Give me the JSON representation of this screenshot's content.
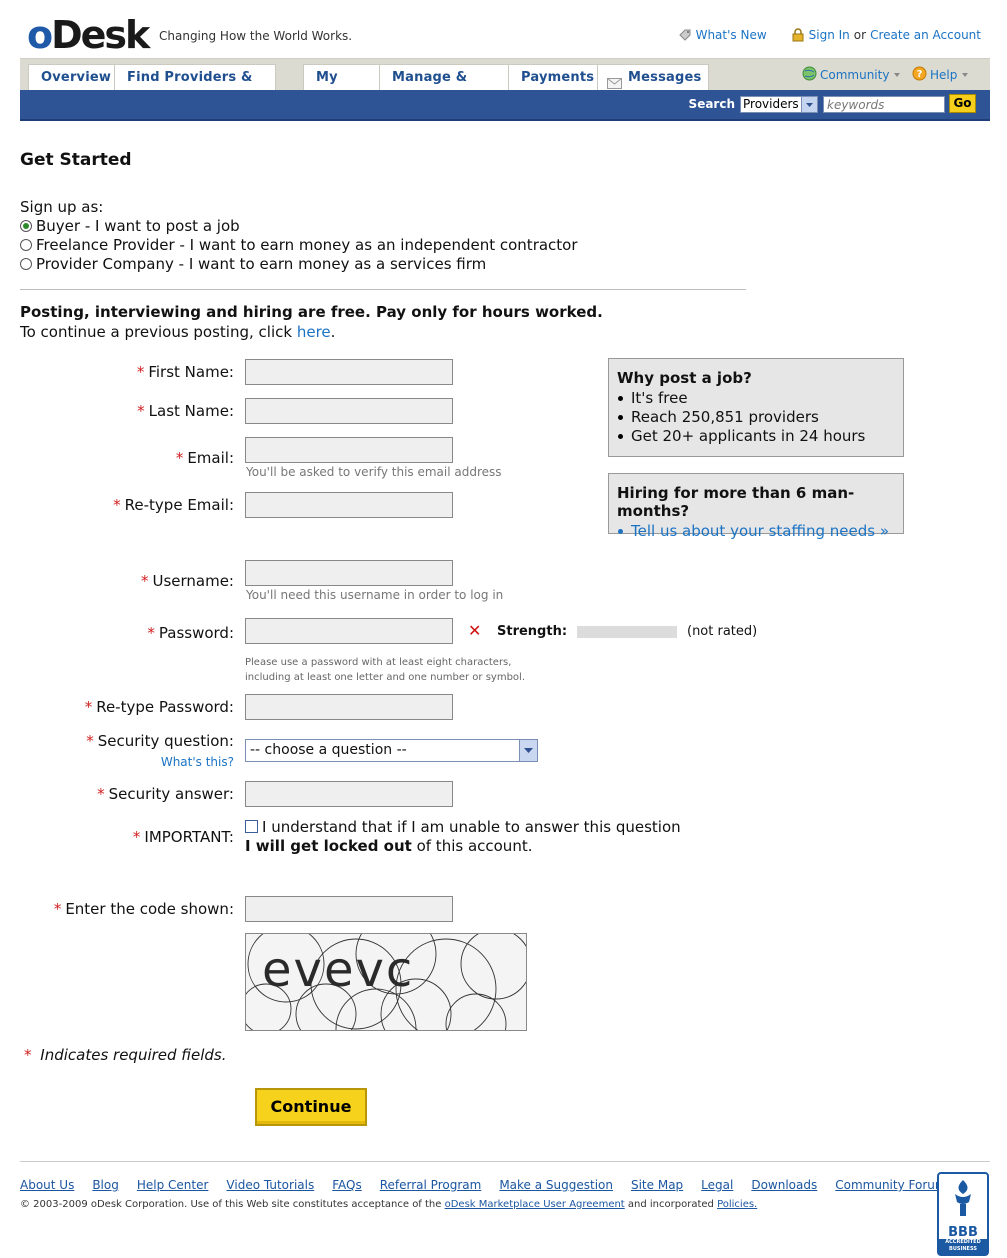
{
  "header": {
    "logo_o": "o",
    "logo_desk": "Desk",
    "tagline": "Changing How the World Works.",
    "whats_new": "What's New",
    "sign_in": "Sign In",
    "or_text": "or",
    "create_account": "Create an Account"
  },
  "tabs": {
    "overview": "Overview",
    "find_providers": "Find Providers & Jobs",
    "my_jobs": "My Jobs",
    "manage_work": "Manage & Work",
    "payments": "Payments",
    "messages": "Messages",
    "community": "Community",
    "help": "Help"
  },
  "search": {
    "label": "Search",
    "scope": "Providers",
    "placeholder": "keywords",
    "go": "Go"
  },
  "page": {
    "title": "Get Started",
    "signup_label": "Sign up as:",
    "options": [
      {
        "label": "Buyer - I want to post a job",
        "selected": true
      },
      {
        "label": "Freelance Provider - I want to earn money as an independent contractor",
        "selected": false
      },
      {
        "label": "Provider Company - I want to earn money as a services firm",
        "selected": false
      }
    ],
    "promo_bold": "Posting, interviewing and hiring are free. Pay only for hours worked.",
    "promo_prefix": "To continue a previous posting, click ",
    "promo_link": "here",
    "promo_suffix": "."
  },
  "form": {
    "required_mark": "*",
    "first_name": "First Name:",
    "last_name": "Last Name:",
    "email": "Email:",
    "email_hint": "You'll be asked to verify this email address",
    "retype_email": "Re-type Email:",
    "username": "Username:",
    "username_hint": "You'll need this username in order to log in",
    "password": "Password:",
    "strength_label": "Strength:",
    "strength_value": "(not rated)",
    "password_hint_1": "Please use a password with at least eight characters,",
    "password_hint_2": "including at least one letter and one number or symbol.",
    "retype_password": "Re-type Password:",
    "security_question": "Security question:",
    "whats_this": "What's this?",
    "security_select": "-- choose a question --",
    "security_answer": "Security answer:",
    "important": "IMPORTANT:",
    "important_text_1": "I understand that if I am unable to answer this question",
    "important_bold": "I will get locked out",
    "important_text_2": " of this account.",
    "captcha_label": "Enter the code shown:",
    "captcha_code": "evevc",
    "required_note": "Indicates required fields.",
    "continue": "Continue"
  },
  "sidebar": {
    "box1_title": "Why post a job?",
    "box1_items": [
      "It's free",
      "Reach 250,851 providers",
      "Get 20+ applicants in 24 hours"
    ],
    "box2_title": "Hiring for more than 6 man-months?",
    "box2_link": "Tell us about your staffing needs »"
  },
  "footer": {
    "links": [
      "About Us",
      "Blog",
      "Help Center",
      "Video Tutorials",
      "FAQs",
      "Referral Program",
      "Make a Suggestion",
      "Site Map",
      "Legal",
      "Downloads",
      "Community Forums"
    ],
    "copyright_prefix": "© 2003-2009 oDesk Corporation. Use of this Web site constitutes acceptance of the ",
    "agreement_link": "oDesk Marketplace User Agreement",
    "copyright_mid": " and incorporated ",
    "policies_link": "Policies.",
    "bbb_text": "BBB",
    "bbb_sub": "ACCREDITED BUSINESS"
  },
  "colors": {
    "nav_blue": "#2f5496",
    "link_blue": "#1b73c4",
    "button_yellow": "#f6d21c",
    "required_red": "#d02020"
  }
}
